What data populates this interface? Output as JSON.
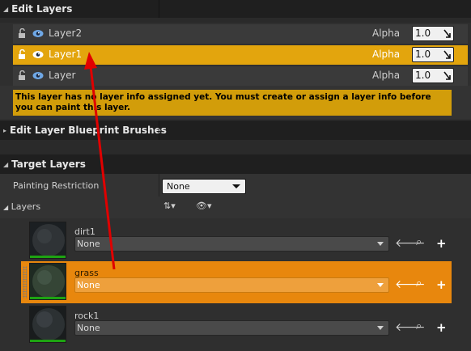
{
  "edit_layers": {
    "header": "Edit Layers",
    "alpha_label": "Alpha",
    "layers": [
      {
        "name": "Layer2",
        "alpha": "1.0",
        "selected": false
      },
      {
        "name": "Layer1",
        "alpha": "1.0",
        "selected": true
      },
      {
        "name": "Layer",
        "alpha": "1.0",
        "selected": false
      }
    ],
    "warning": "This layer has no layer info assigned yet. You must create or assign a layer info before you can paint this layer."
  },
  "blueprint_brushes": {
    "header": "Edit Layer Blueprint Brushes"
  },
  "target_layers": {
    "header": "Target Layers",
    "painting_restriction_label": "Painting Restriction",
    "painting_restriction_value": "None",
    "layers_label": "Layers",
    "items": [
      {
        "name": "dirt1",
        "asset": "None",
        "selected": false
      },
      {
        "name": "grass",
        "asset": "None",
        "selected": true
      },
      {
        "name": "rock1",
        "asset": "None",
        "selected": false
      }
    ]
  },
  "colors": {
    "accent_selected": "#e3a50d",
    "target_selected": "#e8870d",
    "annotation_arrow": "#e00000",
    "warning": "#d29d0a"
  }
}
